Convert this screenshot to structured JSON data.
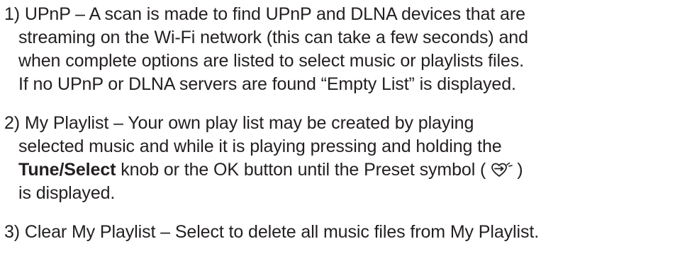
{
  "items": [
    {
      "lines": [
        "1) UPnP – A scan is made to find UPnP and DLNA devices that are",
        "streaming on the Wi-Fi network (this can take a few seconds) and",
        "when complete options are listed to select music or playlists files.",
        "If no UPnP or DLNA servers are found “Empty List” is displayed."
      ]
    },
    {
      "line1": "2) My Playlist – Your own play list may be created by playing",
      "line2": "selected music and while it is playing pressing and holding the",
      "line3_bold": "Tune/Select",
      "line3_mid": " knob or the OK button until the Preset symbol (",
      "line3_end": ")",
      "line4": "is displayed.",
      "icon": "preset-heart-icon"
    },
    {
      "lines": [
        "3) Clear My Playlist – Select to delete all music files from My Playlist."
      ]
    }
  ]
}
